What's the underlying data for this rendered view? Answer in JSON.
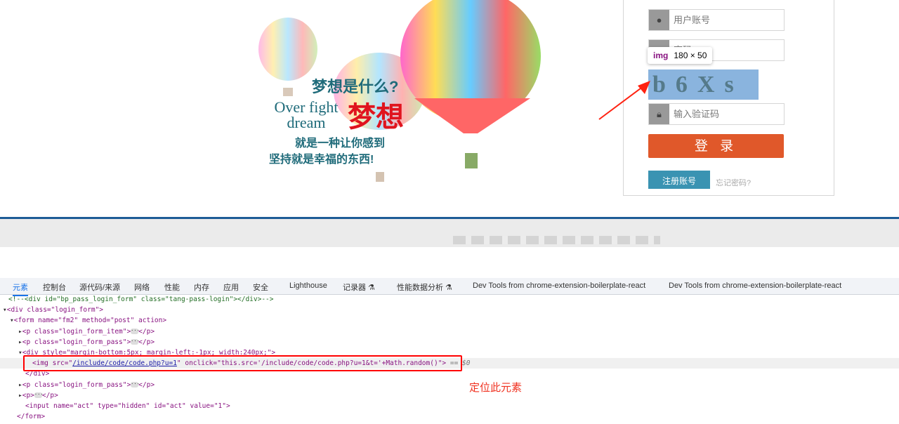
{
  "banner": {
    "line1": "梦想是什么?",
    "line2a": "Over fight",
    "line2b": "dream",
    "line3": "梦想",
    "line4": "就是一种让你感到",
    "line5": "坚持就是幸福的东西!"
  },
  "login": {
    "username_placeholder": "用户账号",
    "password_placeholder": "密码",
    "captcha_text": "b6Xs",
    "captcha_placeholder": "输入验证码",
    "login_button": "登 录",
    "register_button": "注册账号",
    "forgot_link": "忘记密码?"
  },
  "tooltip": {
    "tag": "img",
    "size": "180 × 50"
  },
  "devtools": {
    "tabs": [
      "元素",
      "控制台",
      "源代码/来源",
      "网络",
      "性能",
      "内存",
      "应用",
      "安全",
      "Lighthouse",
      "记录器 ⚗",
      "性能数据分析 ⚗",
      "Dev Tools from chrome-extension-boilerplate-react",
      "Dev Tools from chrome-extension-boilerplate-react"
    ],
    "lines": {
      "l0": "<!--<div id=\"bp_pass_login_form\" class=\"tang-pass-login\"></div>-->",
      "l1": "<div class=\"login_form\">",
      "l2": "<form name=\"fm2\" method=\"post\" action>",
      "l3": "<p class=\"login_form_item\">",
      "l4": "<p class=\"login_form_pass\">",
      "l5": "<div style=\"margin-bottom:5px; margin-left:-1px; width:240px;\">",
      "l6a": "<img src=\"",
      "l6src": "/include/code/code.php?u=1",
      "l6b": "\" onclick=\"this.src='/include/code/code.php?u=1&t='+Math.random()\">",
      "l6c": "== $0",
      "l7": "</div>",
      "l8": "<p class=\"login_form_pass\">",
      "l9": "<p>",
      "l10": "<input name=\"act\" type=\"hidden\" id=\"act\" value=\"1\">",
      "l11": "</form>",
      "pclose": "</p>"
    }
  },
  "annotation": "定位此元素"
}
